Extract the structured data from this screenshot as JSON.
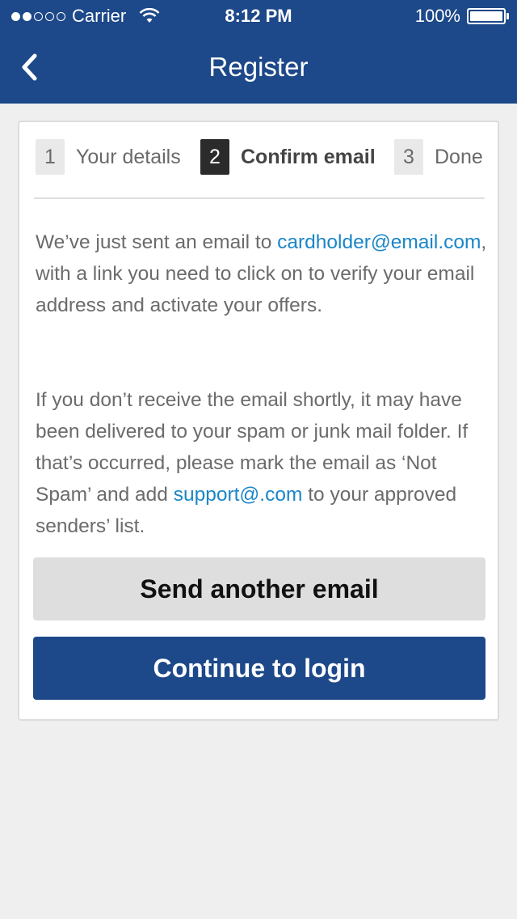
{
  "status_bar": {
    "carrier": "Carrier",
    "time": "8:12 PM",
    "battery": "100%",
    "icons": [
      "signal-icon",
      "wifi-icon",
      "battery-icon"
    ]
  },
  "nav": {
    "title": "Register",
    "back_icon": "chevron-left-icon"
  },
  "steps": [
    {
      "number": "1",
      "label": "Your details",
      "active": false
    },
    {
      "number": "2",
      "label": "Confirm email",
      "active": true
    },
    {
      "number": "3",
      "label": "Done",
      "active": false
    }
  ],
  "message": {
    "p1_before": "We’ve just sent an email to ",
    "email": "cardholder@email.com",
    "p1_after": ", with a link you need to click on to verify your email address and activate your offers.",
    "p2_before": "If you don’t receive the email shortly, it may have been delivered to your spam or junk mail folder. If that’s occurred, please mark the email as ‘Not Spam’ and add ",
    "support_email": "support@.com",
    "p2_after": " to your approved senders’ list."
  },
  "buttons": {
    "resend": "Send another email",
    "continue": "Continue to login"
  },
  "colors": {
    "brand": "#1d4889",
    "link": "#1a86c8",
    "background": "#efeff0"
  }
}
